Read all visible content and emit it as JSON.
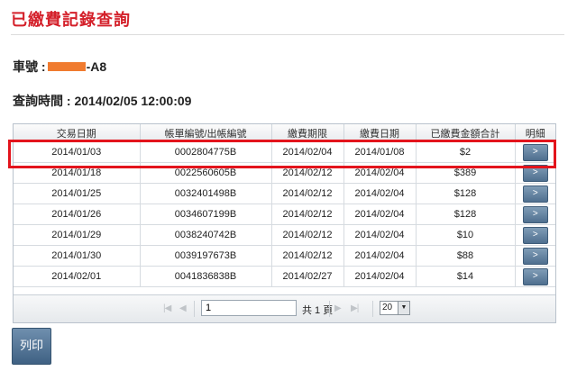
{
  "page": {
    "title": "已繳費記錄查詢"
  },
  "info": {
    "plate_label": "車號 :",
    "plate_value": "-A8",
    "query_time_label": "查詢時間 :",
    "query_time_value": "2014/02/05 12:00:09"
  },
  "table": {
    "headers": [
      "交易日期",
      "帳單編號/出帳編號",
      "繳費期限",
      "繳費日期",
      "已繳費金額合計",
      "明細"
    ],
    "rows": [
      {
        "date": "2014/01/03",
        "bill_no": "0002804775B",
        "due": "2014/02/04",
        "paid": "2014/01/08",
        "amount": "$2",
        "detail": ">"
      },
      {
        "date": "2014/01/18",
        "bill_no": "0022560605B",
        "due": "2014/02/12",
        "paid": "2014/02/04",
        "amount": "$389",
        "detail": ">"
      },
      {
        "date": "2014/01/25",
        "bill_no": "0032401498B",
        "due": "2014/02/12",
        "paid": "2014/02/04",
        "amount": "$128",
        "detail": ">"
      },
      {
        "date": "2014/01/26",
        "bill_no": "0034607199B",
        "due": "2014/02/12",
        "paid": "2014/02/04",
        "amount": "$128",
        "detail": ">"
      },
      {
        "date": "2014/01/29",
        "bill_no": "0038240742B",
        "due": "2014/02/12",
        "paid": "2014/02/04",
        "amount": "$10",
        "detail": ">"
      },
      {
        "date": "2014/01/30",
        "bill_no": "0039197673B",
        "due": "2014/02/12",
        "paid": "2014/02/04",
        "amount": "$88",
        "detail": ">"
      },
      {
        "date": "2014/02/01",
        "bill_no": "0041836838B",
        "due": "2014/02/27",
        "paid": "2014/02/04",
        "amount": "$14",
        "detail": ">"
      }
    ]
  },
  "pager": {
    "current_page": "1",
    "total_text": "共 1 頁",
    "rows_per_page": "20"
  },
  "actions": {
    "print_label": "列印"
  },
  "colors": {
    "title": "#d4202a",
    "highlight": "#e3141c",
    "redaction": "#f07b2f",
    "button": "#4f6f8f"
  },
  "icons": {
    "first_page": "first-page-icon",
    "prev_page": "prev-page-icon",
    "next_page": "next-page-icon",
    "last_page": "last-page-icon",
    "dropdown": "chevron-down-icon"
  }
}
